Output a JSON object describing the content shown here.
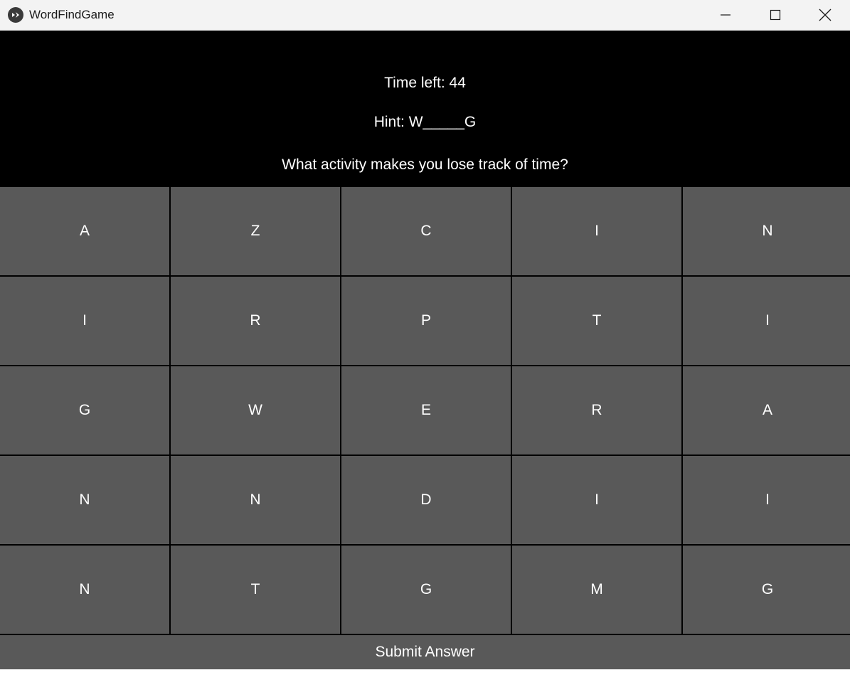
{
  "window": {
    "title": "WordFindGame",
    "icons": {
      "app": "kivy-logo-icon",
      "minimize": "minimize-icon",
      "maximize": "maximize-icon",
      "close": "close-icon"
    }
  },
  "header": {
    "time_left": "Time left: 44",
    "hint": "Hint: W_____G",
    "question": "What activity makes you lose track of time?"
  },
  "grid": {
    "rows": [
      [
        "A",
        "Z",
        "C",
        "I",
        "N"
      ],
      [
        "I",
        "R",
        "P",
        "T",
        "I"
      ],
      [
        "G",
        "W",
        "E",
        "R",
        "A"
      ],
      [
        "N",
        "N",
        "D",
        "I",
        "I"
      ],
      [
        "N",
        "T",
        "G",
        "M",
        "G"
      ]
    ]
  },
  "submit_label": "Submit Answer",
  "colors": {
    "background": "#000000",
    "button": "#595959",
    "text": "#ffffff",
    "titlebar": "#f3f3f3"
  }
}
